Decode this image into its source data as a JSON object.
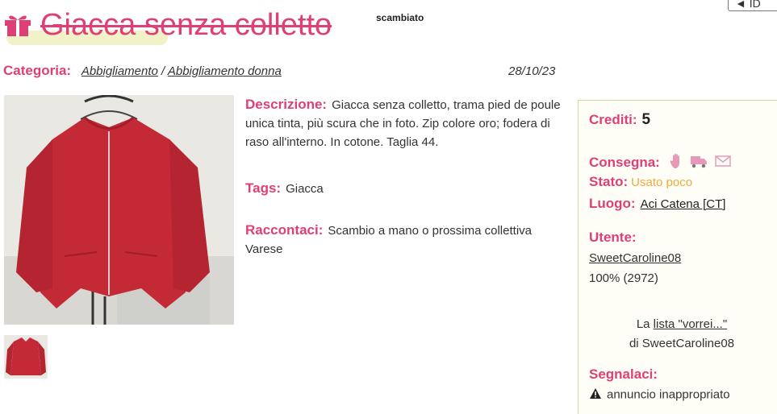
{
  "header": {
    "title": "Giacca senza colletto",
    "status_tag": "scambiato",
    "back_label": "◄ ID"
  },
  "category": {
    "label": "Categoria:",
    "level1": "Abbigliamento",
    "separator": "/",
    "level2": "Abbigliamento donna",
    "date": "28/10/23"
  },
  "details": {
    "description_label": "Descrizione:",
    "description_text": "Giacca senza colletto, trama pied de poule unica tinta, più scura che in foto. Zip colore oro; fodera di raso all'interno. In cotone. Taglia 44.",
    "tags_label": "Tags:",
    "tags_value": "Giacca",
    "story_label": "Raccontaci:",
    "story_text": "Scambio a mano o prossima collettiva Varese"
  },
  "panel": {
    "credits_label": "Crediti:",
    "credits_value": "5",
    "delivery_label": "Consegna:",
    "delivery_icons": [
      "hand-icon",
      "truck-icon",
      "mail-icon"
    ],
    "state_label": "Stato:",
    "state_value": "Usato poco",
    "place_label": "Luogo:",
    "place_value": "Aci Catena [CT]",
    "user_label": "Utente:",
    "user_name": "SweetCaroline08",
    "user_rating": "100% (2972)",
    "wishlist_prefix": "La",
    "wishlist_link": "lista \"vorrei...\"",
    "wishlist_suffix": "di SweetCaroline08",
    "report_label": "Segnalaci:",
    "report_link": "annuncio inappropriato"
  },
  "colors": {
    "accent": "#de3f76",
    "state": "#f2a93b",
    "jacket": "#c42a36",
    "panel_border": "#d6dca0"
  }
}
